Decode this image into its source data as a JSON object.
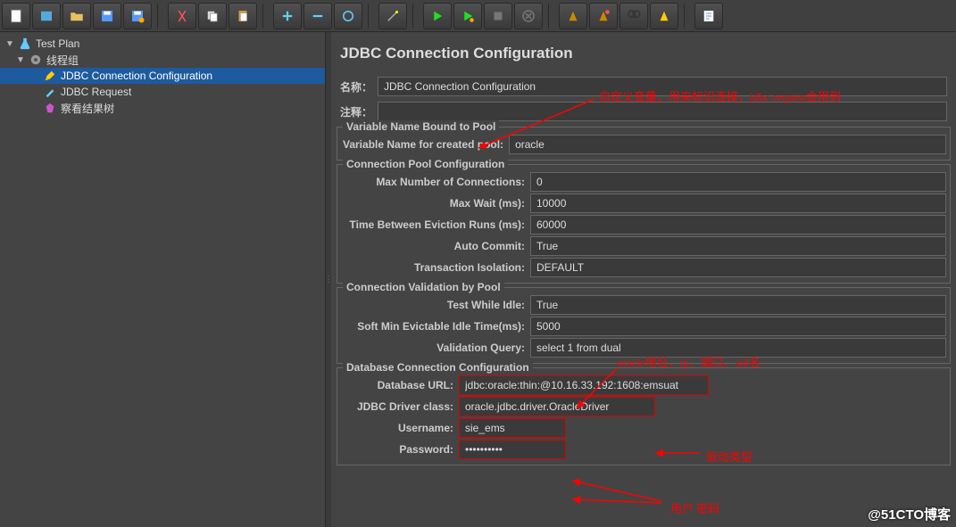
{
  "tree": {
    "root": "Test Plan",
    "threadGroup": "线程组",
    "jdbcConfig": "JDBC Connection Configuration",
    "jdbcRequest": "JDBC Request",
    "viewResults": "察看结果树"
  },
  "panel": {
    "title": "JDBC Connection Configuration",
    "nameLabel": "名称：",
    "nameValue": "JDBC Connection Configuration",
    "commentLabel": "注释：",
    "commentValue": ""
  },
  "pool": {
    "legend": "Variable Name Bound to Pool",
    "varLabel": "Variable Name for created pool:",
    "varValue": "oracle"
  },
  "cfg": {
    "legend": "Connection Pool Configuration",
    "maxConnLabel": "Max Number of Connections:",
    "maxConnValue": "0",
    "maxWaitLabel": "Max Wait (ms):",
    "maxWaitValue": "10000",
    "timeLabel": "Time Between Eviction Runs (ms):",
    "timeValue": "60000",
    "autoLabel": "Auto Commit:",
    "autoValue": "True",
    "isoLabel": "Transaction Isolation:",
    "isoValue": "DEFAULT"
  },
  "val": {
    "legend": "Connection Validation by Pool",
    "idleLabel": "Test While Idle:",
    "idleValue": "True",
    "softMinLabel": "Soft Min Evictable Idle Time(ms):",
    "softMinValue": "5000",
    "queryLabel": "Validation Query:",
    "queryValue": "select 1 from dual"
  },
  "db": {
    "legend": "Database Connection Configuration",
    "urlLabel": "Database URL:",
    "urlValue": "jdbc:oracle:thin:@10.16.33.192:1608:emsuat",
    "drvLabel": "JDBC Driver class:",
    "drvValue": "oracle.jdbc.driver.OracleDriver",
    "userLabel": "Username:",
    "userValue": "sie_ems",
    "passLabel": "Password:",
    "passValue": "••••••••••"
  },
  "anno": {
    "a1": "自定义变量，用来标识连接，jdbc request会用到",
    "a2": "oracle地址，ip、端口、sid名",
    "a3": "驱动类型",
    "a4": "用户 密码"
  },
  "watermark": "@51CTO博客"
}
